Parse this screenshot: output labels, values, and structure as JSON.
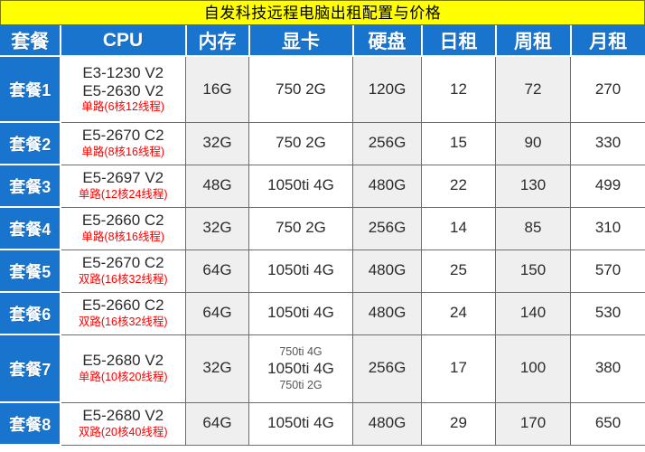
{
  "title": {
    "text": "自发科技远程电脑出租配置与价格",
    "background": "#FFFF00",
    "color": "#000000"
  },
  "theme": {
    "header_blue": "#1874CD",
    "shade_gray": "#EFEFEF",
    "note_red": "#FF0000",
    "border_gray": "#6D6D6D"
  },
  "table": {
    "columns": [
      {
        "key": "plan",
        "label": "套餐"
      },
      {
        "key": "cpu",
        "label": "CPU"
      },
      {
        "key": "memory",
        "label": "内存"
      },
      {
        "key": "gpu",
        "label": "显卡"
      },
      {
        "key": "disk",
        "label": "硬盘"
      },
      {
        "key": "daily",
        "label": "日租"
      },
      {
        "key": "weekly",
        "label": "周租"
      },
      {
        "key": "monthly",
        "label": "月租"
      }
    ],
    "rows": [
      {
        "plan": "套餐1",
        "cpu_models": [
          "E3-1230 V2",
          "E5-2630 V2"
        ],
        "cpu_note": "单路(6核12线程)",
        "memory": "16G",
        "gpu_lines": [
          "750 2G"
        ],
        "disk": "120G",
        "daily": "12",
        "weekly": "72",
        "monthly": "270"
      },
      {
        "plan": "套餐2",
        "cpu_models": [
          "E5-2670 C2"
        ],
        "cpu_note": "单路(8核16线程)",
        "memory": "32G",
        "gpu_lines": [
          "750 2G"
        ],
        "disk": "256G",
        "daily": "15",
        "weekly": "90",
        "monthly": "330"
      },
      {
        "plan": "套餐3",
        "cpu_models": [
          "E5-2697 V2"
        ],
        "cpu_note": "单路(12核24线程)",
        "memory": "48G",
        "gpu_lines": [
          "1050ti 4G"
        ],
        "disk": "480G",
        "daily": "22",
        "weekly": "130",
        "monthly": "499"
      },
      {
        "plan": "套餐4",
        "cpu_models": [
          "E5-2660 C2"
        ],
        "cpu_note": "单路(8核16线程)",
        "memory": "32G",
        "gpu_lines": [
          "750 2G"
        ],
        "disk": "256G",
        "daily": "14",
        "weekly": "85",
        "monthly": "310"
      },
      {
        "plan": "套餐5",
        "cpu_models": [
          "E5-2670 C2"
        ],
        "cpu_note": "双路(16核32线程)",
        "memory": "64G",
        "gpu_lines": [
          "1050ti 4G"
        ],
        "disk": "480G",
        "daily": "25",
        "weekly": "150",
        "monthly": "570"
      },
      {
        "plan": "套餐6",
        "cpu_models": [
          "E5-2660 C2"
        ],
        "cpu_note": "双路(16核32线程)",
        "memory": "64G",
        "gpu_lines": [
          "1050ti 4G"
        ],
        "disk": "480G",
        "daily": "24",
        "weekly": "140",
        "monthly": "530"
      },
      {
        "plan": "套餐7",
        "cpu_models": [
          "E5-2680 V2"
        ],
        "cpu_note": "单路(10核20线程)",
        "memory": "32G",
        "gpu_lines": [
          "750ti 4G",
          "1050ti 4G",
          "750ti 2G"
        ],
        "gpu_emphasis_index": 1,
        "disk": "256G",
        "daily": "17",
        "weekly": "100",
        "monthly": "380"
      },
      {
        "plan": "套餐8",
        "cpu_models": [
          "E5-2680 V2"
        ],
        "cpu_note": "双路(20核40线程)",
        "memory": "64G",
        "gpu_lines": [
          "1050ti 4G"
        ],
        "disk": "480G",
        "daily": "29",
        "weekly": "170",
        "monthly": "650"
      }
    ]
  }
}
